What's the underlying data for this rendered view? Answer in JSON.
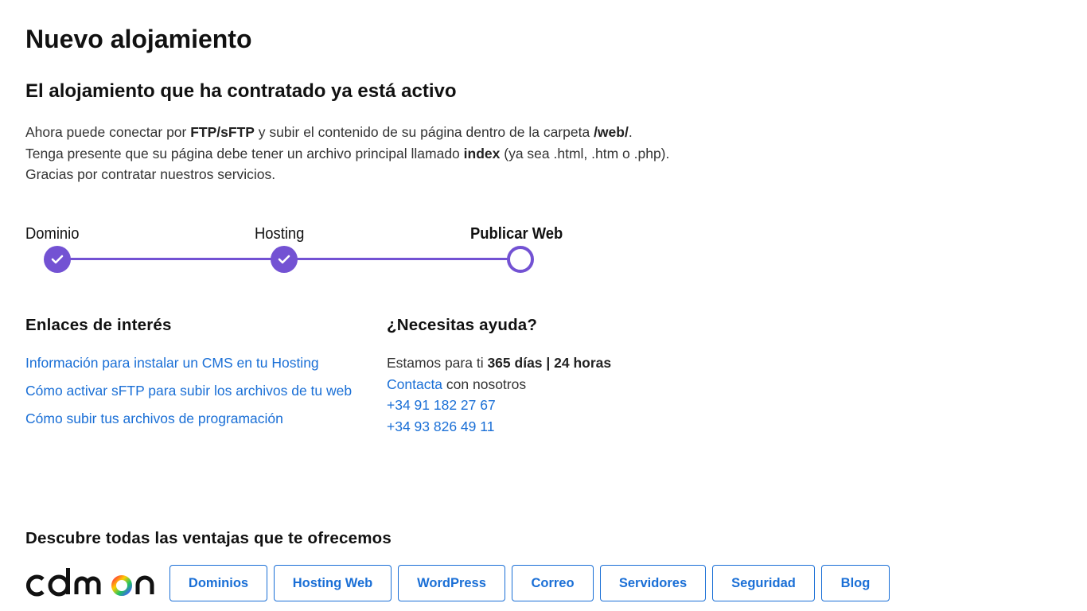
{
  "page": {
    "title": "Nuevo alojamiento",
    "subtitle": "El alojamiento que ha contratado ya está activo"
  },
  "intro": {
    "line1_a": "Ahora puede conectar por ",
    "line1_b": "FTP/sFTP",
    "line1_c": " y subir el contenido de su página dentro de la carpeta ",
    "line1_d": "/web/",
    "line1_e": ".",
    "line2_a": "Tenga presente que su página debe tener un archivo principal llamado ",
    "line2_b": "index",
    "line2_c": " (ya sea .html, .htm o .php).",
    "line3": "Gracias por contratar nuestros servicios."
  },
  "steps": {
    "items": [
      {
        "label": "Dominio",
        "status": "completed"
      },
      {
        "label": "Hosting",
        "status": "completed"
      },
      {
        "label": "Publicar Web",
        "status": "current"
      }
    ],
    "accent": "#7352d3"
  },
  "links_section": {
    "heading": "Enlaces de interés",
    "links": [
      "Información para instalar un CMS en tu Hosting",
      "Cómo activar sFTP para subir los archivos de tu web",
      "Cómo subir tus archivos de programación"
    ]
  },
  "help_section": {
    "heading": "¿Necesitas ayuda?",
    "availability_prefix": "Estamos para ti ",
    "availability_bold": "365 días | 24 horas",
    "contact_link": "Contacta",
    "contact_suffix": " con nosotros",
    "phones": [
      "+34 91 182 27 67",
      "+34 93 826 49 11"
    ]
  },
  "footer": {
    "heading": "Descubre todas las ventajas que te ofrecemos",
    "logo_text": "cdmon",
    "nav": [
      "Dominios",
      "Hosting Web",
      "WordPress",
      "Correo",
      "Servidores",
      "Seguridad",
      "Blog"
    ]
  },
  "colors": {
    "link": "#1a6fd6",
    "accent": "#7352d3"
  }
}
